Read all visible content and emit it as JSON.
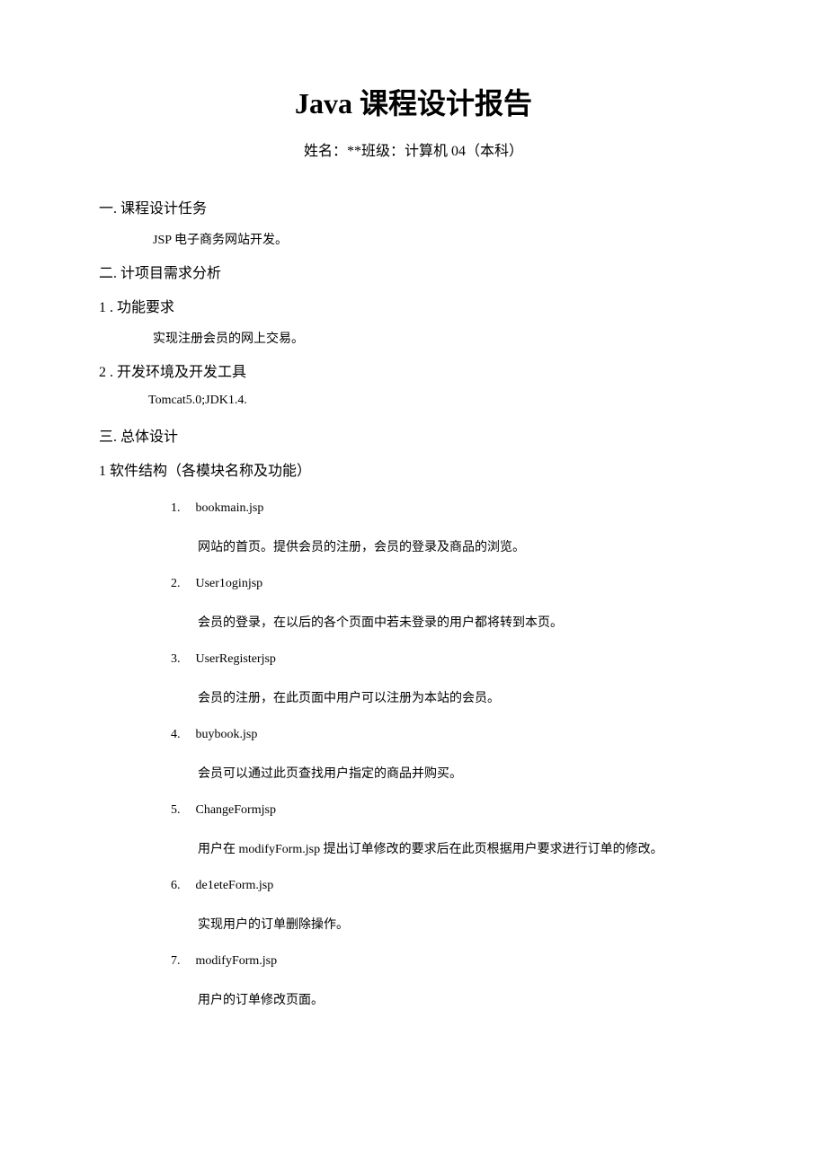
{
  "title": "Java 课程设计报告",
  "subtitle": "姓名：**班级：计算机 04（本科）",
  "section1": {
    "heading": "一. 课程设计任务",
    "content": "JSP 电子商务网站开发。"
  },
  "section2": {
    "heading": "二. 计项目需求分析",
    "sub1": {
      "heading": "1 . 功能要求",
      "content": "实现注册会员的网上交易。"
    },
    "sub2": {
      "heading": "2 . 开发环境及开发工具",
      "content": "Tomcat5.0;JDK1.4."
    }
  },
  "section3": {
    "heading": "三. 总体设计",
    "sub1": {
      "heading": "1 软件结构（各模块名称及功能）"
    },
    "modules": [
      {
        "num": "1.",
        "name": "bookmain.jsp",
        "desc": "网站的首页。提供会员的注册，会员的登录及商品的浏览。"
      },
      {
        "num": "2.",
        "name": "User1oginjsp",
        "desc": "会员的登录，在以后的各个页面中若未登录的用户都将转到本页。"
      },
      {
        "num": "3.",
        "name": "UserRegisterjsp",
        "desc": "会员的注册，在此页面中用户可以注册为本站的会员。"
      },
      {
        "num": "4.",
        "name": "buybook.jsp",
        "desc": "会员可以通过此页查找用户指定的商品并购买。"
      },
      {
        "num": "5.",
        "name": "ChangeFormjsp",
        "desc": "用户在 modifyForm.jsp 提出订单修改的要求后在此页根据用户要求进行订单的修改。"
      },
      {
        "num": "6.",
        "name": "de1eteForm.jsp",
        "desc": "实现用户的订单删除操作。"
      },
      {
        "num": "7.",
        "name": "modifyForm.jsp",
        "desc": "用户的订单修改页面。"
      }
    ]
  }
}
